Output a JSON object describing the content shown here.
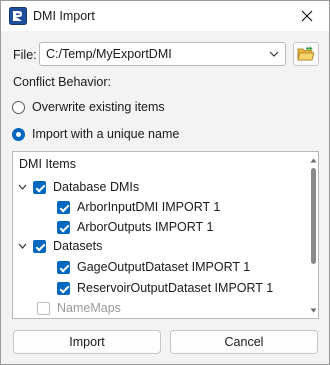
{
  "window": {
    "title": "DMI Import"
  },
  "file": {
    "label": "File:",
    "value": "C:/Temp/MyExportDMI"
  },
  "conflict": {
    "label": "Conflict Behavior:",
    "options": [
      {
        "label": "Overwrite existing items",
        "checked": false
      },
      {
        "label": "Import with a unique name",
        "checked": true
      }
    ]
  },
  "tree": {
    "header": "DMI Items",
    "groups": [
      {
        "label": "Database DMIs",
        "checked": true,
        "expanded": true,
        "children": [
          {
            "label": "ArborInputDMI IMPORT 1",
            "checked": true
          },
          {
            "label": "ArborOutputs IMPORT 1",
            "checked": true
          }
        ]
      },
      {
        "label": "Datasets",
        "checked": true,
        "expanded": true,
        "children": [
          {
            "label": "GageOutputDataset IMPORT 1",
            "checked": true
          },
          {
            "label": "ReservoirOutputDataset IMPORT 1",
            "checked": true
          }
        ]
      }
    ],
    "disabled_items": [
      {
        "label": "NameMaps",
        "checked": false
      }
    ]
  },
  "buttons": {
    "import": "Import",
    "cancel": "Cancel"
  },
  "colors": {
    "accent": "#0067c0",
    "window_bg": "#f3f3f3",
    "panel_bg": "#ffffff"
  },
  "icons": {
    "app": "riverware-app-icon",
    "close": "close-icon",
    "browse": "open-folder-icon"
  }
}
